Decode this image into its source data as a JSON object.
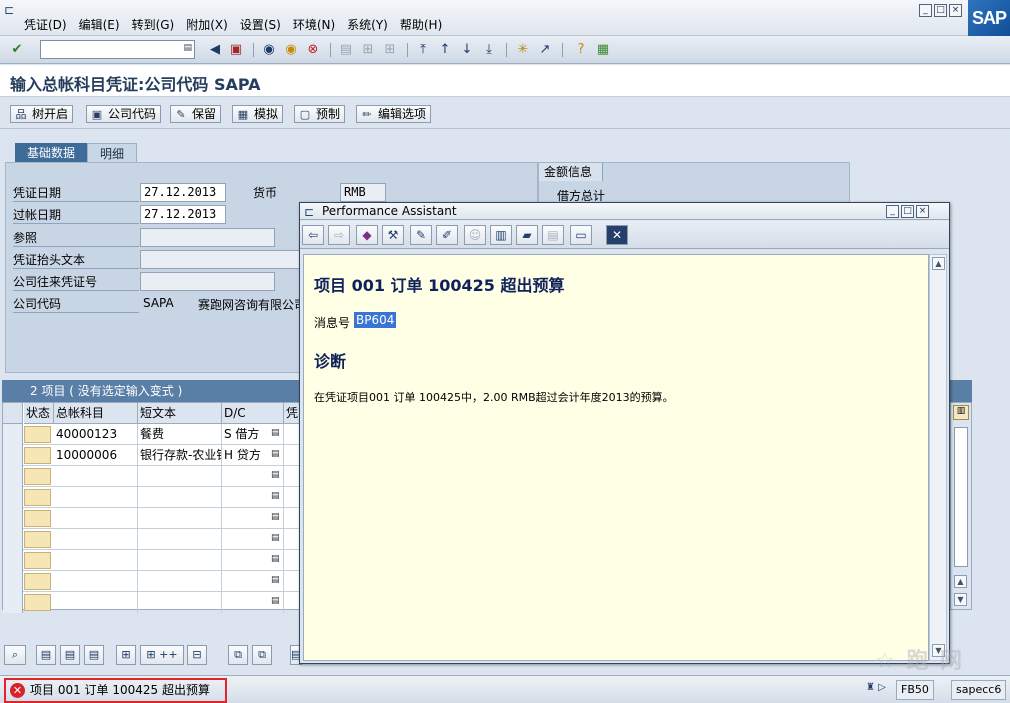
{
  "menubar": {
    "items": [
      "凭证(D)",
      "编辑(E)",
      "转到(G)",
      "附加(X)",
      "设置(S)",
      "环境(N)",
      "系统(Y)",
      "帮助(H)"
    ]
  },
  "window_buttons": [
    "_",
    "□",
    "×"
  ],
  "logo": {
    "text": "SAP"
  },
  "toolbar": {
    "command_value": "",
    "command_dropdown": "▤",
    "icons": [
      "enter-icon",
      "back-icon",
      "save-icon",
      "back-nav-icon",
      "exit-icon",
      "cancel-icon",
      "print-icon",
      "find-icon",
      "find-next-icon",
      "first-page-icon",
      "previous-page-icon",
      "next-page-icon",
      "last-page-icon",
      "create-session-icon",
      "shortcut-icon",
      "help-icon",
      "layout-icon"
    ]
  },
  "title": "输入总帐科目凭证:公司代码 SAPA",
  "app_toolbar": {
    "buttons": [
      {
        "label": "树开启",
        "icon": "品"
      },
      {
        "label": "公司代码",
        "icon": "▣"
      },
      {
        "label": "保留",
        "icon": "✎"
      },
      {
        "label": "模拟",
        "icon": "▦"
      },
      {
        "label": "预制",
        "icon": "▢"
      },
      {
        "label": "编辑选项",
        "icon": "✏"
      }
    ]
  },
  "tabs": [
    {
      "label": "基础数据",
      "active": true
    },
    {
      "label": "明细",
      "active": false
    }
  ],
  "header": {
    "fields": {
      "doc_date_label": "凭证日期",
      "doc_date": "27.12.2013",
      "post_date_label": "过帐日期",
      "post_date": "27.12.2013",
      "reference_label": "参照",
      "reference": "",
      "header_text_label": "凭证抬头文本",
      "header_text": "",
      "trading_partner_label": "公司往来凭证号",
      "trading_partner": "",
      "company_code_label": "公司代码",
      "company_code": "SAPA",
      "company_name": "赛跑网咨询有限公司",
      "currency_label": "货币",
      "currency": "RMB"
    }
  },
  "amount_info": {
    "tab": "金额信息",
    "debit_total_label": "借方总计"
  },
  "grid": {
    "title": "2 项目 ( 没有选定输入变式 )",
    "columns": [
      "状态",
      "总帐科目",
      "短文本",
      "D/C",
      "凭"
    ],
    "rows": [
      {
        "account": "40000123",
        "text": "餐费",
        "dc": "S 借方"
      },
      {
        "account": "10000006",
        "text": "银行存款-农业银行",
        "dc": "H 贷方"
      },
      {
        "account": "",
        "text": "",
        "dc": ""
      },
      {
        "account": "",
        "text": "",
        "dc": ""
      },
      {
        "account": "",
        "text": "",
        "dc": ""
      },
      {
        "account": "",
        "text": "",
        "dc": ""
      },
      {
        "account": "",
        "text": "",
        "dc": ""
      },
      {
        "account": "",
        "text": "",
        "dc": ""
      },
      {
        "account": "",
        "text": "",
        "dc": ""
      }
    ]
  },
  "dialog": {
    "title": "Performance Assistant",
    "heading": "项目 001 订单 100425 超出预算",
    "msg_label": "消息号",
    "msg_number": "BP604",
    "diagnosis_heading": "诊断",
    "diagnosis_text": "在凭证项目001 订单 100425中，2.00 RMB超过会计年度2013的预算。",
    "toolbar_icons": [
      "back-arrow-icon",
      "forward-arrow-icon",
      "book-icon",
      "tech-info-icon",
      "edit-icon",
      "glossary-icon",
      "person-icon",
      "table-icon",
      "bookmark-icon",
      "print-icon",
      "window-icon",
      "close-icon"
    ]
  },
  "statusbar": {
    "message": "项目 001 订单 100425 超出预算",
    "transaction": "FB50",
    "server": "sapecc6"
  },
  "colors": {
    "error": "#d8232a",
    "highlight_border": "#e3242b",
    "dialog_bg": "#ffffe6",
    "grid_header": "#5a7fa6"
  }
}
